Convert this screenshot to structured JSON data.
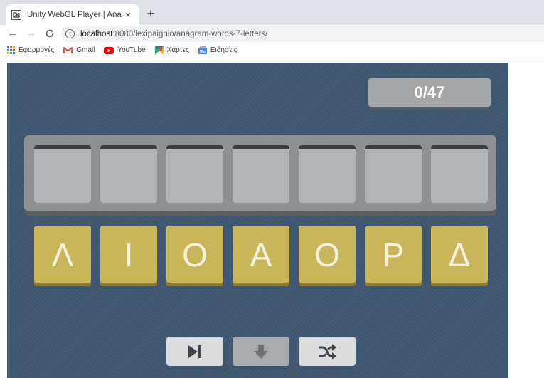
{
  "browser": {
    "tab_title": "Unity WebGL Player | Anagramin",
    "tab_close": "×",
    "new_tab": "+",
    "url_host": "localhost",
    "url_rest": ":8080/lexipaignio/anagram-words-7-letters/",
    "bookmarks": [
      {
        "label": "Εφαρμογές",
        "icon": "apps-grid-icon"
      },
      {
        "label": "Gmail",
        "icon": "gmail-icon"
      },
      {
        "label": "YouTube",
        "icon": "youtube-icon"
      },
      {
        "label": "Χάρτες",
        "icon": "maps-icon"
      },
      {
        "label": "Ειδήσεις",
        "icon": "news-icon"
      }
    ]
  },
  "game": {
    "score": "0/47",
    "slot_count": 7,
    "letters": [
      "Λ",
      "Ι",
      "Ο",
      "Α",
      "Ο",
      "Ρ",
      "Δ"
    ],
    "controls": [
      {
        "name": "skip",
        "icon": "skip-forward-icon"
      },
      {
        "name": "drop",
        "icon": "arrow-down-icon"
      },
      {
        "name": "shuffle",
        "icon": "shuffle-icon"
      }
    ],
    "colors": {
      "background": "#3e566f",
      "tile": "#c9b55a",
      "slot": "#b3b4b6",
      "panel": "#8e9091"
    }
  }
}
